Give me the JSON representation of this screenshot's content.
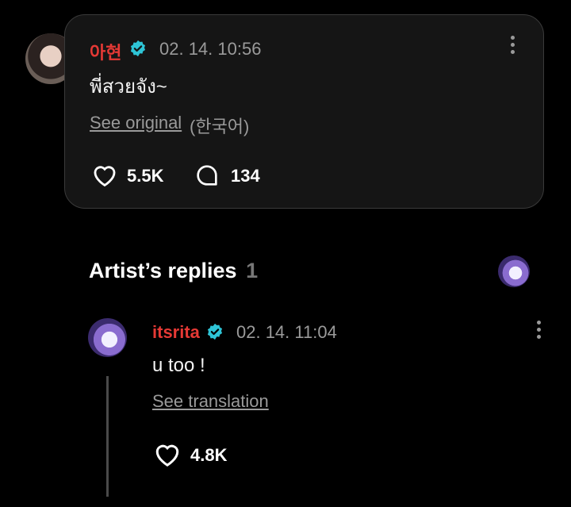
{
  "post": {
    "author": "아현",
    "timestamp": "02. 14. 10:56",
    "text": "พี่สวยจัง~",
    "see_original": "See original",
    "original_lang": "(한국어)",
    "likes": "5.5K",
    "comments": "134",
    "avatar_icon": "user-avatar-photo"
  },
  "replies_section": {
    "title": "Artist’s replies",
    "count": "1"
  },
  "reply": {
    "author": "itsrita",
    "timestamp": "02. 14. 11:04",
    "text": "u too !",
    "see_translation": "See translation",
    "likes": "4.8K"
  },
  "colors": {
    "background": "#000000",
    "card": "#151515",
    "username": "#e53935",
    "verified": "#2ec4d6",
    "muted": "#9a9a9a"
  }
}
